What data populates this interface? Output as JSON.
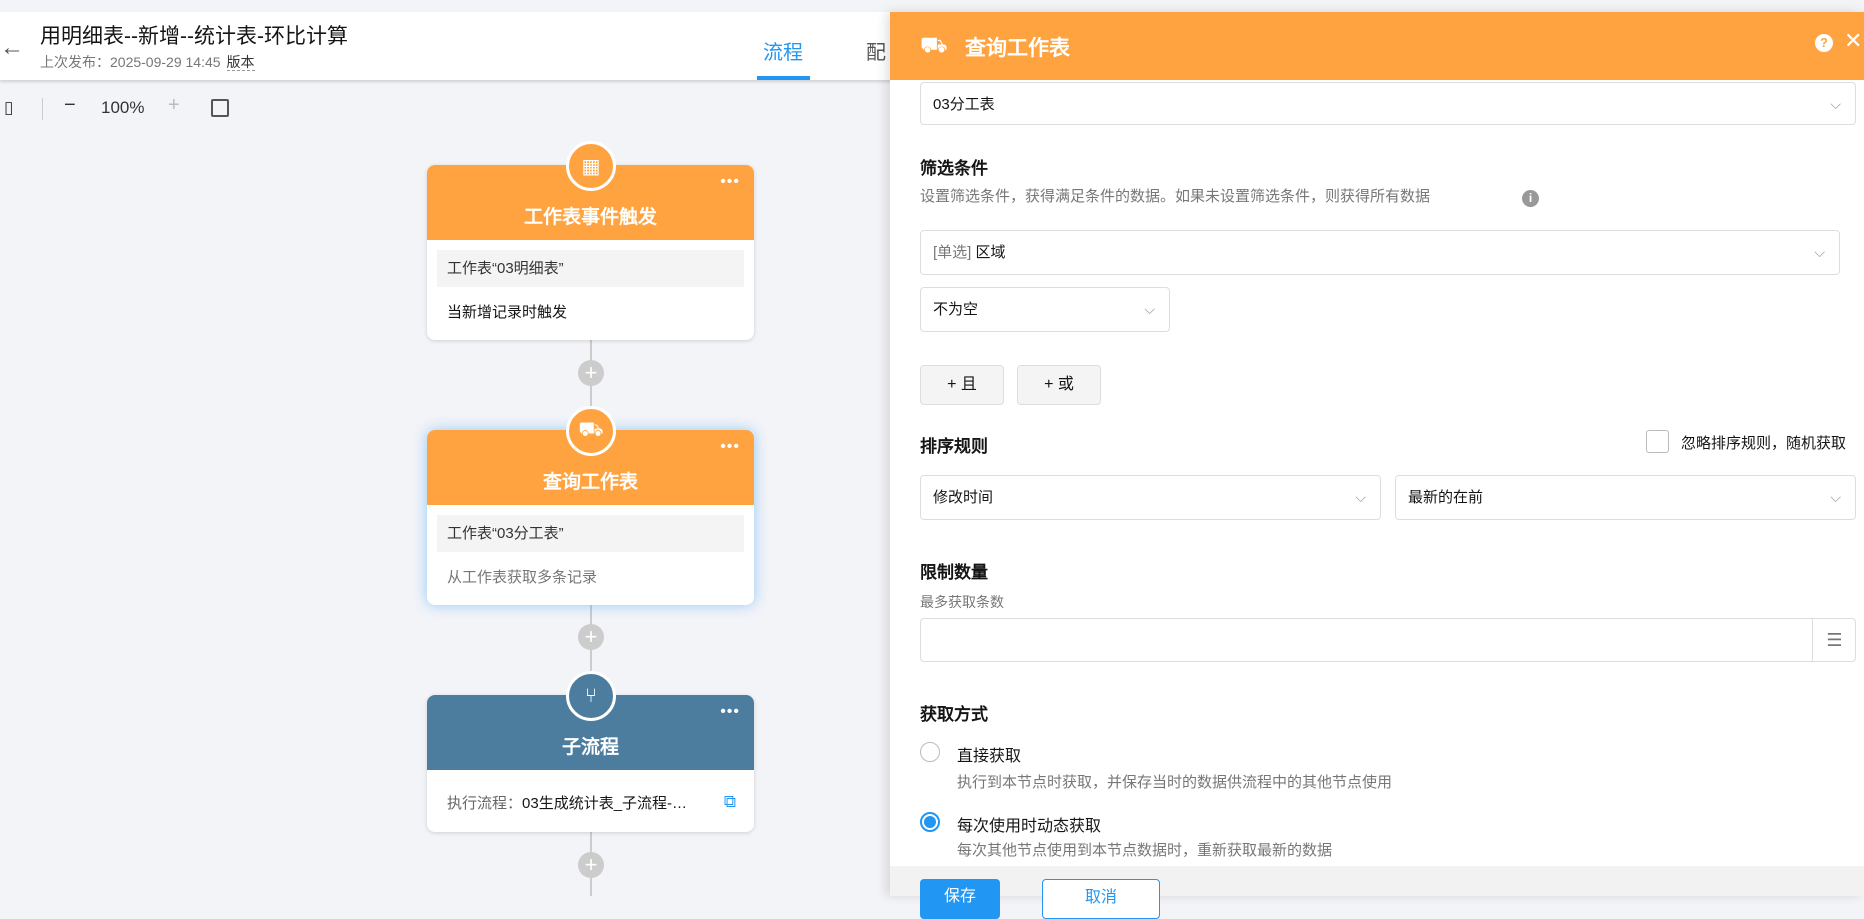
{
  "header": {
    "back_icon": "arrow-left-icon",
    "title": "用明细表--新增--统计表-环比计算",
    "published_label": "上次发布：2025-09-29 14:45",
    "version_link": "版本",
    "tabs": [
      {
        "label": "流程",
        "active": true
      },
      {
        "label": "配"
      }
    ]
  },
  "toolbar": {
    "zoom": "100%",
    "minus": "−",
    "plus": "+"
  },
  "nodes": [
    {
      "title": "工作表事件触发",
      "box": "工作表“03明细表”",
      "text": "当新增记录时触发",
      "color": "#ffa340",
      "icon": "table-icon"
    },
    {
      "title": "查询工作表",
      "box": "工作表“03分工表”",
      "text": "从工作表获取多条记录",
      "color": "#ffa340",
      "icon": "truck-icon"
    },
    {
      "title": "子流程",
      "label": "执行流程：",
      "value": "03生成统计表_子流程-…",
      "color": "#4c7d9e",
      "icon": "subprocess-icon"
    }
  ],
  "panel": {
    "title": "查询工作表",
    "worksheet": "03分工表",
    "filter": {
      "heading": "筛选条件",
      "desc": "设置筛选条件，获得满足条件的数据。如果未设置筛选条件，则获得所有数据",
      "field_tag": "[单选]",
      "field": "区域",
      "operator": "不为空",
      "and_btn": "+ 且",
      "or_btn": "+ 或"
    },
    "sort": {
      "heading": "排序规则",
      "ignore_label": "忽略排序规则，随机获取",
      "ignore_checked": false,
      "field": "修改时间",
      "order": "最新的在前"
    },
    "limit": {
      "heading": "限制数量",
      "desc": "最多获取条数",
      "value": ""
    },
    "mode": {
      "heading": "获取方式",
      "options": [
        {
          "label": "直接获取",
          "desc": "执行到本节点时获取，并保存当时的数据供流程中的其他节点使用",
          "selected": false
        },
        {
          "label": "每次使用时动态获取",
          "desc": "每次其他节点使用到本节点数据时，重新获取最新的数据",
          "selected": true
        }
      ]
    },
    "save": "保存",
    "cancel": "取消"
  }
}
